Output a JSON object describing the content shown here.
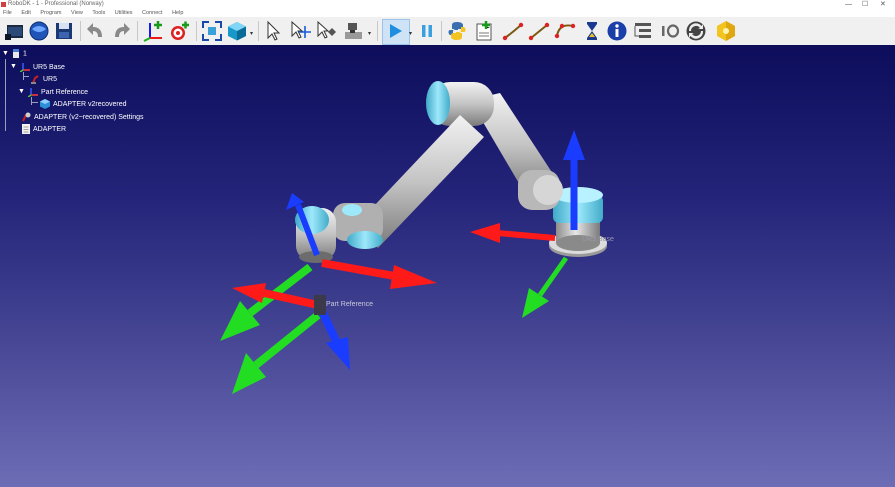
{
  "window": {
    "title": "RoboDK - 1 - Professional (Norway)",
    "controls": [
      "—",
      "☐",
      "✕"
    ]
  },
  "menu": [
    "File",
    "Edit",
    "Program",
    "View",
    "Tools",
    "Utilities",
    "Connect",
    "Help"
  ],
  "toolbar": {
    "groups": [
      [
        "open-icon",
        "online-library-icon",
        "save-icon"
      ],
      [
        "undo-icon",
        "redo-icon"
      ],
      [
        "add-reference-frame-icon",
        "add-target-icon"
      ],
      [
        "fit-all-icon",
        "iso-view-icon"
      ],
      [
        "select-icon",
        "move-reference-icon",
        "move-tool-icon",
        "collision-icon"
      ],
      [
        "run-program-icon",
        "pause-icon"
      ],
      [
        "python-icon",
        "add-program-icon",
        "move-joint-icon",
        "move-linear-icon",
        "move-circular-icon",
        "pause-instruction-icon",
        "info-icon",
        "program-call-icon",
        "set-io-icon",
        "sync-icon",
        "robot-addin-icon"
      ]
    ]
  },
  "tree": {
    "root": "1",
    "items": [
      {
        "label": "UR5 Base",
        "icon": "frame-icon"
      },
      {
        "label": "UR5",
        "icon": "robot-icon"
      },
      {
        "label": "Part Reference",
        "icon": "frame-icon"
      },
      {
        "label": "ADAPTER v2recovered",
        "icon": "object-icon"
      },
      {
        "label": "ADAPTER (v2~recovered) Settings",
        "icon": "settings-icon"
      },
      {
        "label": "ADAPTER",
        "icon": "program-icon"
      }
    ]
  },
  "viewport": {
    "labels": {
      "part_reference": "Part Reference",
      "base": "UR5 Base"
    },
    "colors": {
      "x_axis": "#ff1a1a",
      "y_axis": "#22dd22",
      "z_axis": "#1a3cff",
      "robot_body": "#c8c8c8",
      "robot_joint": "#6fd6ee"
    }
  }
}
